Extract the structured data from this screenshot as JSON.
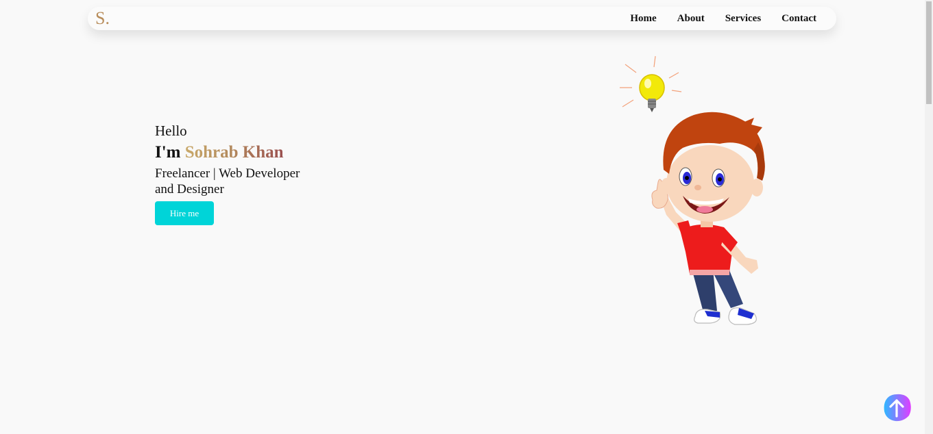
{
  "navbar": {
    "logo": "S.",
    "links": [
      "Home",
      "About",
      "Services",
      "Contact"
    ]
  },
  "hero": {
    "greeting": "Hello",
    "intro_prefix": "I'm ",
    "name": "Sohrab Khan",
    "tagline": "Freelancer | Web Developer and Designer",
    "cta_label": "Hire me"
  },
  "icons": {
    "scroll_top": "arrow-up-icon",
    "illustration": "boy-with-lightbulb-illustration"
  },
  "colors": {
    "background": "#f9f9f9",
    "accent": "#00d4d8",
    "logo": "#b88d5b",
    "name_gradient_start": "#c9a96a",
    "name_gradient_end": "#9a4f4f"
  }
}
